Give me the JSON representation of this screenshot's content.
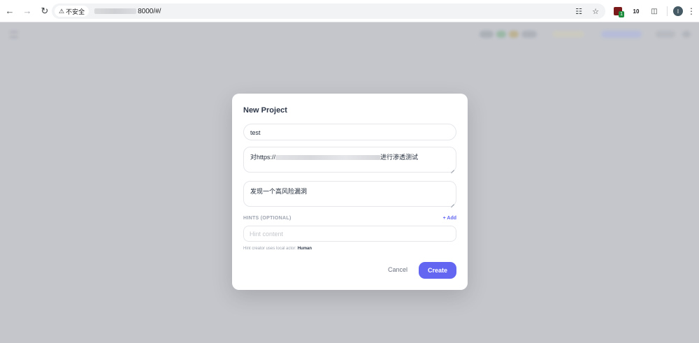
{
  "browser": {
    "security_label": "不安全",
    "url_suffix": "8000/#/",
    "extension_badge": "1",
    "extension_count": "10",
    "profile_initial": "I"
  },
  "modal": {
    "title": "New Project",
    "name_value": "test",
    "target_prefix": "对https://",
    "target_suffix": "进行渗透测试",
    "description_value": "发现一个高风险漏洞",
    "hints_label": "HINTS (OPTIONAL)",
    "add_label": "+ Add",
    "hint_placeholder": "Hint content",
    "hint_note_prefix": "Hint creator uses local actor:",
    "hint_note_actor": "Human",
    "cancel_label": "Cancel",
    "create_label": "Create"
  },
  "colors": {
    "accent": "#6366f1",
    "overlay": "#c4c6cc"
  }
}
